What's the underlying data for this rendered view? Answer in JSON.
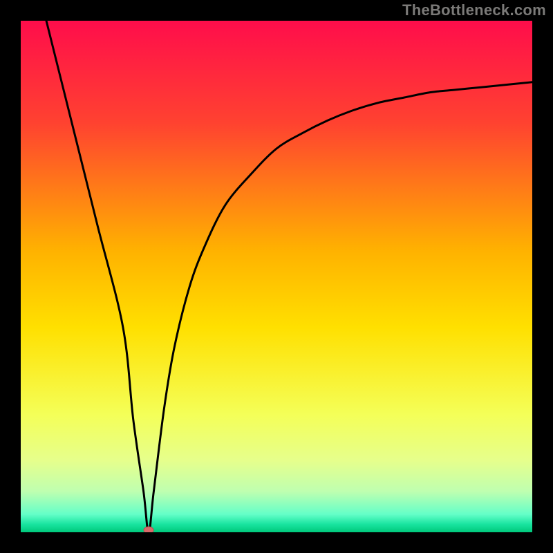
{
  "watermark": "TheBottleneck.com",
  "chart_data": {
    "type": "line",
    "title": "",
    "xlabel": "",
    "ylabel": "",
    "xlim": [
      0,
      100
    ],
    "ylim": [
      0,
      100
    ],
    "grid": false,
    "legend": false,
    "x": [
      5,
      10,
      15,
      20,
      22,
      24,
      25,
      26,
      28,
      30,
      33,
      36,
      40,
      45,
      50,
      55,
      60,
      65,
      70,
      75,
      80,
      85,
      90,
      95,
      100
    ],
    "y": [
      100.0,
      80.0,
      60.0,
      40.0,
      22.0,
      8.0,
      0.0,
      8.0,
      24.0,
      36.0,
      48.0,
      56.0,
      64.0,
      70.0,
      75.0,
      78.0,
      80.5,
      82.5,
      84.0,
      85.0,
      86.0,
      86.5,
      87.0,
      87.5,
      88.0
    ],
    "marker": {
      "x": 25,
      "y": 0
    },
    "background_gradient": {
      "stops": [
        {
          "offset": 0.0,
          "color": "#ff0d4b"
        },
        {
          "offset": 0.2,
          "color": "#ff4230"
        },
        {
          "offset": 0.45,
          "color": "#ffb200"
        },
        {
          "offset": 0.6,
          "color": "#ffe000"
        },
        {
          "offset": 0.77,
          "color": "#f4ff58"
        },
        {
          "offset": 0.86,
          "color": "#e6ff8c"
        },
        {
          "offset": 0.92,
          "color": "#bfffb0"
        },
        {
          "offset": 0.965,
          "color": "#64ffc8"
        },
        {
          "offset": 0.985,
          "color": "#17e39e"
        },
        {
          "offset": 1.0,
          "color": "#00c87b"
        }
      ]
    }
  }
}
